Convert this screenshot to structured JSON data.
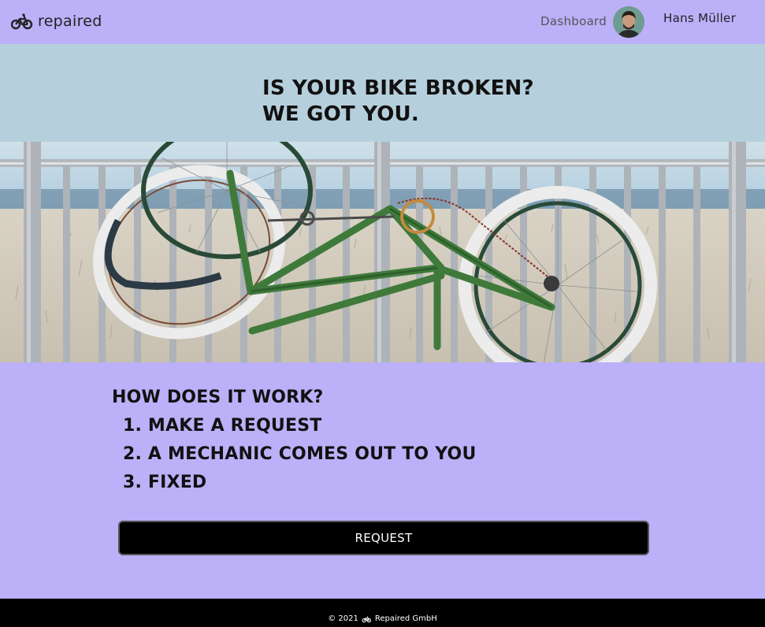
{
  "navbar": {
    "brand_name": "repaired",
    "dashboard_label": "Dashboard",
    "user_name": "Hans Müller"
  },
  "hero": {
    "line1": "IS YOUR BIKE BROKEN?",
    "line2": "WE GOT YOU."
  },
  "how": {
    "title": "HOW DOES IT WORK?",
    "steps": [
      "1. MAKE A REQUEST",
      "2. A MECHANIC COMES OUT TO YOU",
      "3. FIXED"
    ]
  },
  "cta": {
    "request_label": "REQUEST"
  },
  "footer": {
    "copyright_prefix": "© 2021",
    "company": "Repaired GmbH"
  },
  "colors": {
    "page_bg": "#bcb0f8",
    "hero_bg": "#b6cfdc",
    "button_bg": "#000000",
    "footer_bg": "#000000"
  }
}
